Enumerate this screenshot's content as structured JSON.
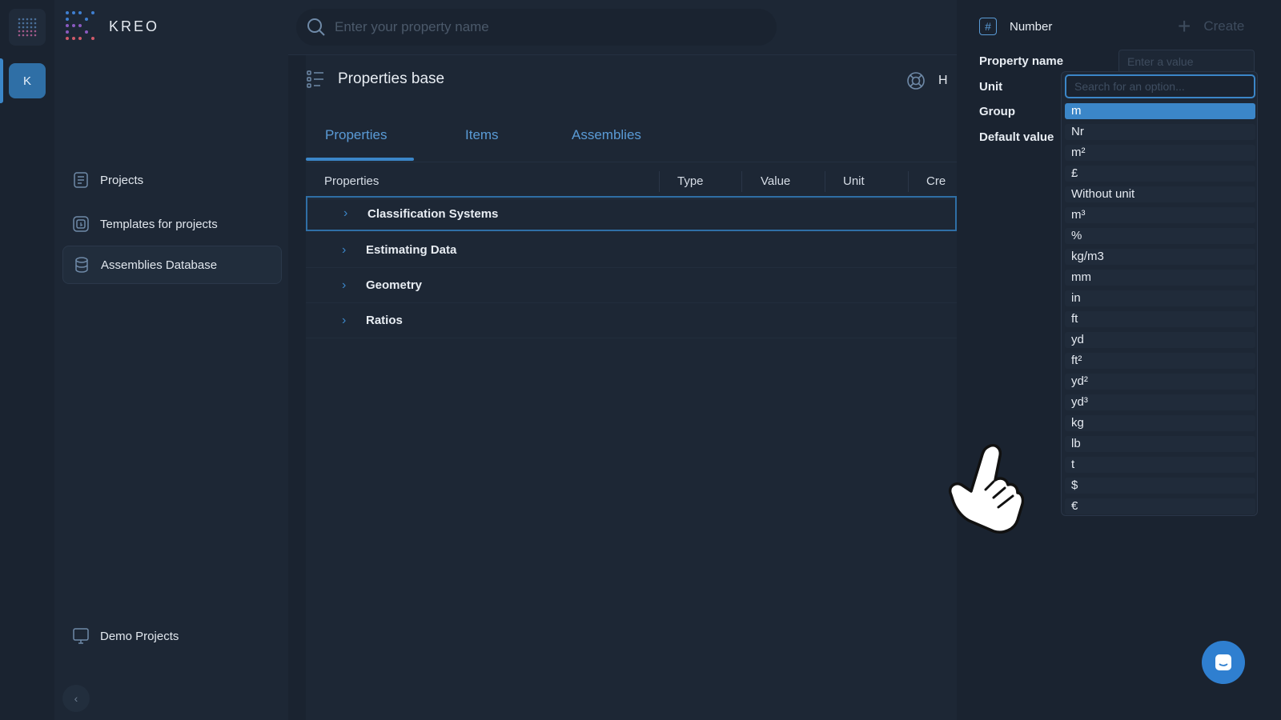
{
  "rail": {
    "avatar_letter": "K"
  },
  "brand": {
    "name": "KREO"
  },
  "sidebar": {
    "items": [
      {
        "label": "Projects",
        "icon": "document-icon"
      },
      {
        "label": "Templates for projects",
        "icon": "templates-icon"
      },
      {
        "label": "Assemblies Database",
        "icon": "database-icon"
      }
    ],
    "bottom_item": {
      "label": "Demo Projects",
      "icon": "monitor-icon"
    }
  },
  "search": {
    "placeholder": "Enter your property name"
  },
  "page": {
    "title": "Properties base",
    "help_label": "H"
  },
  "tabs": [
    {
      "label": "Properties"
    },
    {
      "label": "Items"
    },
    {
      "label": "Assemblies"
    }
  ],
  "table": {
    "columns": [
      "Properties",
      "Type",
      "Value",
      "Unit",
      "Cre"
    ],
    "rows": [
      "Classification Systems",
      "Estimating Data",
      "Geometry",
      "Ratios"
    ]
  },
  "panel": {
    "type_label": "Number",
    "create_label": "Create",
    "fields": {
      "property_name": "Property name",
      "unit": "Unit",
      "group": "Group",
      "default_value": "Default value"
    },
    "value_placeholder": "Enter a value",
    "unit_search_placeholder": "Search for an option...",
    "unit_options": [
      "m",
      "Nr",
      "m²",
      "£",
      "Without unit",
      "m³",
      "%",
      "kg/m3",
      "mm",
      "in",
      "ft",
      "yd",
      "ft²",
      "yd²",
      "yd³",
      "kg",
      "lb",
      "t",
      "$",
      "€"
    ],
    "selected_option": "m"
  },
  "colors": {
    "accent": "#3b86c8",
    "background": "#1d2735",
    "panel": "#1a2330"
  }
}
